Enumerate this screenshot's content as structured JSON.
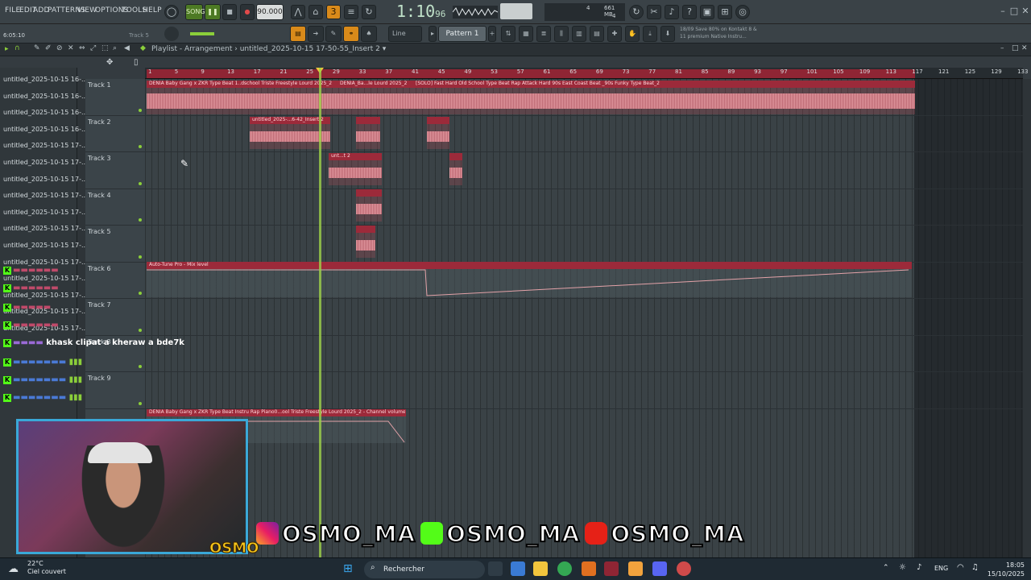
{
  "menu": [
    "FILE",
    "EDIT",
    "ADD",
    "PATTERNS",
    "VIEW",
    "OPTIONS",
    "TOOLS",
    "HELP"
  ],
  "transport": {
    "song_label": "SONG",
    "tempo": "90.000",
    "time_main": "1:10",
    "time_frac": "96",
    "mem": "661 MB",
    "mem_sub": "4",
    "cpu": "4"
  },
  "left_info": {
    "position": "6:05:10",
    "track": "Track 5"
  },
  "toolbar2": {
    "snap": "Line",
    "pattern": "Pattern 1",
    "news": "18/09 Save 80% on Kontakt 8 & 11 premium Native Instru..."
  },
  "playlist": {
    "title": "Playlist - Arrangement",
    "arrangement": "untitled_2025-10-15 17-50-55_Insert 2"
  },
  "browser_items": [
    "untitled_2025-10-15 16-...",
    "untitled_2025-10-15 16-...",
    "untitled_2025-10-15 16-...",
    "untitled_2025-10-15 16-...",
    "untitled_2025-10-15 17-...",
    "untitled_2025-10-15 17-...",
    "untitled_2025-10-15 17-...",
    "untitled_2025-10-15 17-...",
    "untitled_2025-10-15 17-...",
    "untitled_2025-10-15 17-...",
    "untitled_2025-10-15 17-...",
    "untitled_2025-10-15 17-...",
    "untitled_2025-10-15 17-...",
    "untitled_2025-10-15 17-...",
    "untitled_2025-10-15 17-...",
    "untitled_2025-10-15 17-..."
  ],
  "ruler_ticks": [
    "1",
    "5",
    "9",
    "13",
    "17",
    "21",
    "25",
    "29",
    "33",
    "37",
    "41",
    "45",
    "49",
    "53",
    "57",
    "61",
    "65",
    "69",
    "73",
    "77",
    "81",
    "85",
    "89",
    "93",
    "97",
    "101",
    "105",
    "109",
    "113",
    "117",
    "121",
    "125",
    "129",
    "133"
  ],
  "tracks": [
    {
      "name": "Track 1"
    },
    {
      "name": "Track 2"
    },
    {
      "name": "Track 3"
    },
    {
      "name": "Track 4"
    },
    {
      "name": "Track 5"
    },
    {
      "name": "Track 6"
    },
    {
      "name": "Track 7"
    },
    {
      "name": "Track 8"
    },
    {
      "name": "Track 9"
    }
  ],
  "clips": {
    "t1a": "DENIA Baby Gang x ZKR Type Beat 1..dschool Triste Freestyle Lourd 2025_2",
    "t1b": "DENIA_Ba...le Lourd 2025_2",
    "t1c": "[SOLO] Fast Hard Old School Type Beat Rap Attack Hard 90s East Coast Beat _90s Funky Type Beat_2",
    "t2a": "untitled_2025-...6-42_Insert 2",
    "t3a": "unt...t 2",
    "t6a": "Auto-Tune Pro - Mix level",
    "t9a": "DENIA Baby Gang x ZKR Type Beat Instru Rap Piano0...ool Triste Freestyle Lourd 2025_2 - Channel volume"
  },
  "chat": {
    "message": "khask clipat a kheraw a bde7k"
  },
  "social": {
    "handle1": "OSMO_MA",
    "handle2": "OSMO_MA",
    "handle3": "OSMO_MA",
    "brand": "OSMO"
  },
  "taskbar": {
    "weather_temp": "22°C",
    "weather_desc": "Ciel couvert",
    "search": "Rechercher",
    "lang": "ENG",
    "time": "18:05",
    "date": "15/10/2025"
  },
  "colors": {
    "clip_red": "#9c2a3a",
    "playhead": "#9fd24a",
    "accent_orange": "#d98a1a"
  }
}
